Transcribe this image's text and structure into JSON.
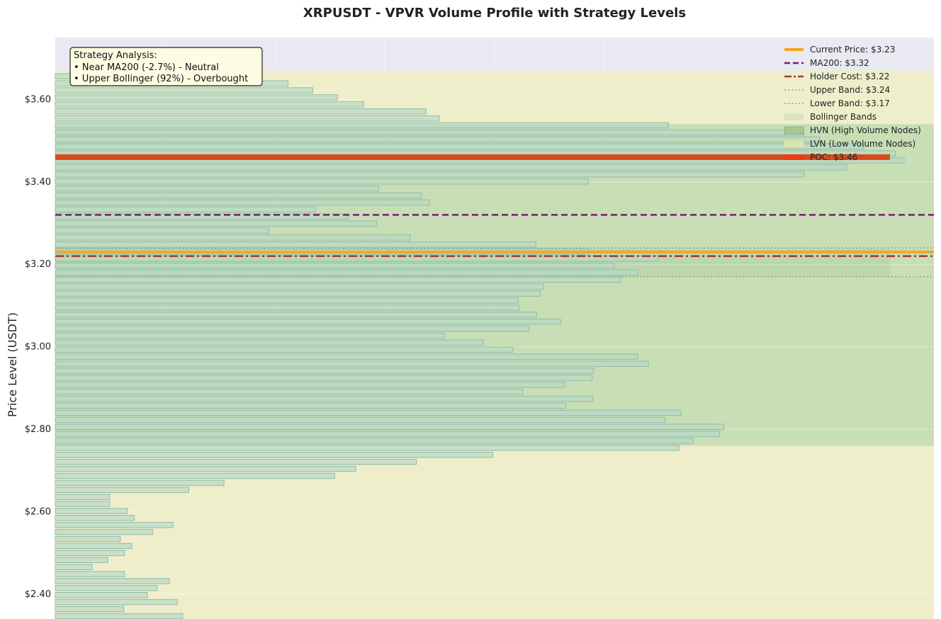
{
  "chart_data": {
    "type": "bar",
    "orientation": "horizontal",
    "title": "XRPUSDT - VPVR Volume Profile with Strategy Levels",
    "ylabel": "Price Level (USDT)",
    "xlabel": "",
    "ylim": [
      2.34,
      3.75
    ],
    "yticks": [
      {
        "value": 2.4,
        "label": "$2.40"
      },
      {
        "value": 2.6,
        "label": "$2.60"
      },
      {
        "value": 2.8,
        "label": "$2.80"
      },
      {
        "value": 3.0,
        "label": "$3.00"
      },
      {
        "value": 3.2,
        "label": "$3.20"
      },
      {
        "value": 3.4,
        "label": "$3.40"
      },
      {
        "value": 3.6,
        "label": "$3.60"
      }
    ],
    "grid": true,
    "legend_position": "top-right",
    "volume_max": 100,
    "bin_width": 0.0128,
    "bins": [
      {
        "price": 2.347,
        "volume": 14.5
      },
      {
        "price": 2.364,
        "volume": 7.8
      },
      {
        "price": 2.381,
        "volume": 13.9
      },
      {
        "price": 2.398,
        "volume": 10.5
      },
      {
        "price": 2.415,
        "volume": 11.6
      },
      {
        "price": 2.432,
        "volume": 13.0
      },
      {
        "price": 2.449,
        "volume": 7.9
      },
      {
        "price": 2.466,
        "volume": 4.2
      },
      {
        "price": 2.483,
        "volume": 6.0
      },
      {
        "price": 2.5,
        "volume": 7.9
      },
      {
        "price": 2.517,
        "volume": 8.7
      },
      {
        "price": 2.534,
        "volume": 7.4
      },
      {
        "price": 2.551,
        "volume": 11.1
      },
      {
        "price": 2.568,
        "volume": 13.4
      },
      {
        "price": 2.585,
        "volume": 9.0
      },
      {
        "price": 2.602,
        "volume": 8.2
      },
      {
        "price": 2.619,
        "volume": 6.2
      },
      {
        "price": 2.636,
        "volume": 6.2
      },
      {
        "price": 2.653,
        "volume": 15.2
      },
      {
        "price": 2.67,
        "volume": 19.2
      },
      {
        "price": 2.687,
        "volume": 31.8
      },
      {
        "price": 2.704,
        "volume": 34.2
      },
      {
        "price": 2.721,
        "volume": 41.1
      },
      {
        "price": 2.738,
        "volume": 49.8
      },
      {
        "price": 2.755,
        "volume": 71.0
      },
      {
        "price": 2.772,
        "volume": 72.6
      },
      {
        "price": 2.789,
        "volume": 75.6
      },
      {
        "price": 2.806,
        "volume": 76.1
      },
      {
        "price": 2.823,
        "volume": 69.4
      },
      {
        "price": 2.84,
        "volume": 71.2
      },
      {
        "price": 2.857,
        "volume": 58.1
      },
      {
        "price": 2.874,
        "volume": 61.2
      },
      {
        "price": 2.891,
        "volume": 53.2
      },
      {
        "price": 2.908,
        "volume": 58.0
      },
      {
        "price": 2.925,
        "volume": 61.1
      },
      {
        "price": 2.942,
        "volume": 61.3
      },
      {
        "price": 2.959,
        "volume": 67.5
      },
      {
        "price": 2.976,
        "volume": 66.3
      },
      {
        "price": 2.993,
        "volume": 52.1
      },
      {
        "price": 3.01,
        "volume": 48.7
      },
      {
        "price": 3.027,
        "volume": 44.3
      },
      {
        "price": 3.044,
        "volume": 53.9
      },
      {
        "price": 3.061,
        "volume": 57.5
      },
      {
        "price": 3.078,
        "volume": 54.8
      },
      {
        "price": 3.095,
        "volume": 52.8
      },
      {
        "price": 3.112,
        "volume": 52.7
      },
      {
        "price": 3.129,
        "volume": 55.2
      },
      {
        "price": 3.146,
        "volume": 55.6
      },
      {
        "price": 3.163,
        "volume": 64.4
      },
      {
        "price": 3.18,
        "volume": 66.3
      },
      {
        "price": 3.197,
        "volume": 63.6
      },
      {
        "price": 3.214,
        "volume": 68.6
      },
      {
        "price": 3.231,
        "volume": 60.7
      },
      {
        "price": 3.248,
        "volume": 54.7
      },
      {
        "price": 3.265,
        "volume": 40.4
      },
      {
        "price": 3.282,
        "volume": 24.3
      },
      {
        "price": 3.299,
        "volume": 36.6
      },
      {
        "price": 3.316,
        "volume": 33.3
      },
      {
        "price": 3.333,
        "volume": 29.6
      },
      {
        "price": 3.35,
        "volume": 42.6
      },
      {
        "price": 3.367,
        "volume": 41.7
      },
      {
        "price": 3.384,
        "volume": 36.8
      },
      {
        "price": 3.401,
        "volume": 60.7
      },
      {
        "price": 3.418,
        "volume": 85.2
      },
      {
        "price": 3.435,
        "volume": 90.1
      },
      {
        "price": 3.452,
        "volume": 96.6
      },
      {
        "price": 3.469,
        "volume": 95.6
      },
      {
        "price": 3.486,
        "volume": 92.0
      },
      {
        "price": 3.503,
        "volume": 87.0
      },
      {
        "price": 3.52,
        "volume": 85.2
      },
      {
        "price": 3.537,
        "volume": 69.8
      },
      {
        "price": 3.554,
        "volume": 43.7
      },
      {
        "price": 3.571,
        "volume": 42.2
      },
      {
        "price": 3.588,
        "volume": 35.1
      },
      {
        "price": 3.605,
        "volume": 32.1
      },
      {
        "price": 3.622,
        "volume": 29.3
      },
      {
        "price": 3.639,
        "volume": 26.5
      },
      {
        "price": 3.656,
        "volume": 23.4
      }
    ],
    "hvn_zones": [
      [
        2.76,
        3.54
      ]
    ],
    "lvn_zones": [
      [
        2.34,
        2.76
      ],
      [
        3.54,
        3.67
      ]
    ],
    "bollinger_band": {
      "upper": 3.24,
      "lower": 3.17
    },
    "lines": {
      "current_price": 3.23,
      "ma200": 3.32,
      "holder_cost": 3.22,
      "upper_band": 3.24,
      "lower_band": 3.17,
      "poc": 3.46
    },
    "colors": {
      "plot_bg": "#e8e9f1",
      "lvn": "#f0eec7",
      "hvn": "#bbd99a",
      "bar_fill": "#b8d8c8",
      "bar_stroke": "#94bca6",
      "current_price": "#f5a31a",
      "ma200": "#7b1a7b",
      "holder_cost": "#a03a2a",
      "band": "#8fa88a",
      "poc": "#d84a1a"
    },
    "legend": [
      {
        "label": "Current Price: $3.23",
        "style": "current"
      },
      {
        "label": "MA200: $3.32",
        "style": "ma200"
      },
      {
        "label": "Holder Cost: $3.22",
        "style": "holder"
      },
      {
        "label": "Upper Band: $3.24",
        "style": "band"
      },
      {
        "label": "Lower Band: $3.17",
        "style": "band"
      },
      {
        "label": "Bollinger Bands",
        "style": "bb"
      },
      {
        "label": "HVN (High Volume Nodes)",
        "style": "hvn"
      },
      {
        "label": "LVN (Low Volume Nodes)",
        "style": "lvn"
      },
      {
        "label": "POC: $3.46",
        "style": "poc"
      }
    ],
    "annotation": {
      "lines": [
        "Strategy Analysis:",
        "• Near MA200 (-2.7%) - Neutral",
        "• Upper Bollinger (92%) - Overbought"
      ]
    }
  }
}
